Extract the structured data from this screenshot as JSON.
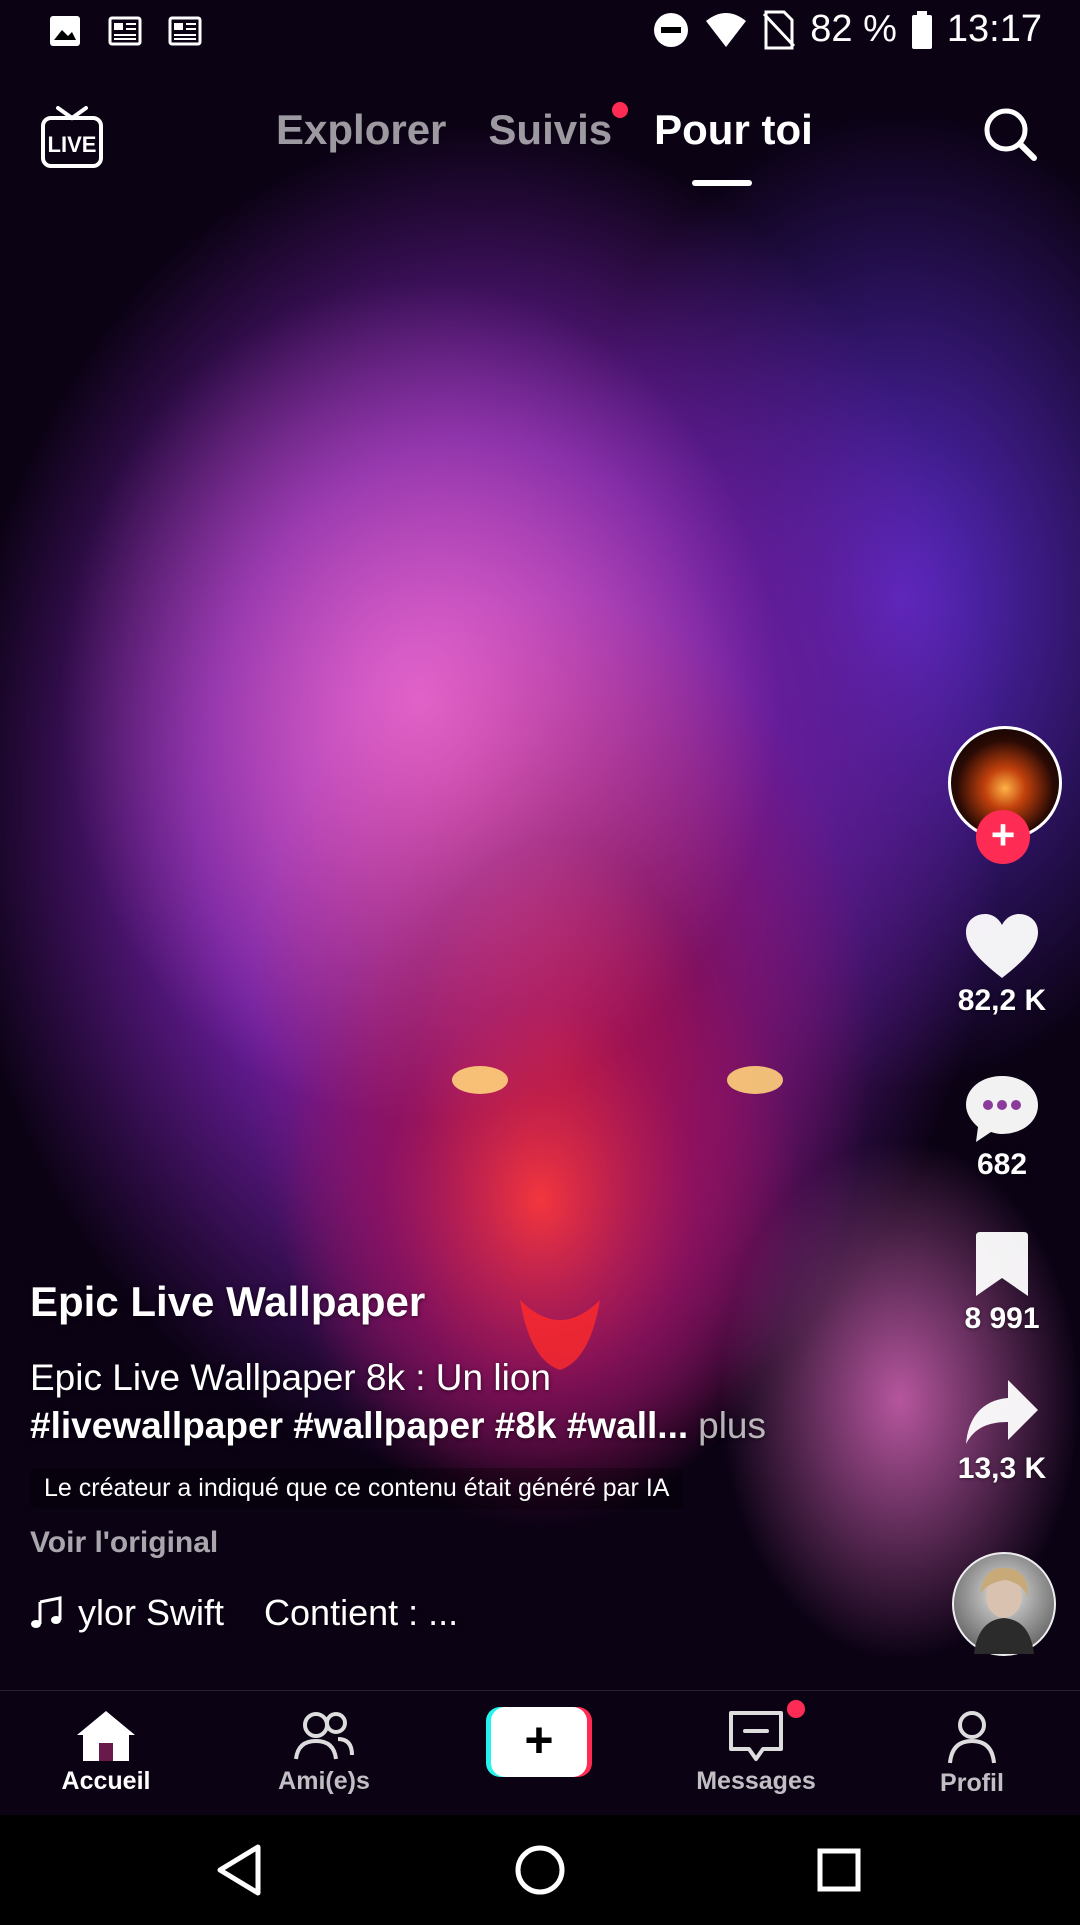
{
  "status_bar": {
    "battery": "82 %",
    "time": "13:17",
    "icons": [
      "gallery-icon",
      "news-icon",
      "news-icon",
      "dnd-icon",
      "wifi-icon",
      "no-sim-icon",
      "battery-icon"
    ]
  },
  "top_nav": {
    "live_label": "LIVE",
    "tabs": [
      {
        "label": "Explorer",
        "active": false
      },
      {
        "label": "Suivis",
        "active": false,
        "notification_dot": true
      },
      {
        "label": "Pour toi",
        "active": true
      }
    ]
  },
  "right_rail": {
    "likes": "82,2 K",
    "comments": "682",
    "saves": "8 991",
    "shares": "13,3 K"
  },
  "post": {
    "creator": "Epic Live Wallpaper",
    "description": "Epic Live Wallpaper 8k : Un lion",
    "hashtags": "#livewallpaper #wallpaper #8k #wall...",
    "more_label": "plus",
    "ai_notice": "Le créateur a indiqué que ce contenu était généré par IA",
    "see_original": "Voir l'original",
    "music": "ylor Swift",
    "contains": "Contient : ..."
  },
  "bottom_nav": {
    "items": [
      {
        "label": "Accueil",
        "active": true
      },
      {
        "label": "Ami(e)s",
        "active": false
      },
      {
        "label": "Messages",
        "active": false,
        "notification_dot": true
      },
      {
        "label": "Profil",
        "active": false
      }
    ]
  },
  "colors": {
    "accent_red": "#fe2c55",
    "accent_cyan": "#25f4ee"
  }
}
